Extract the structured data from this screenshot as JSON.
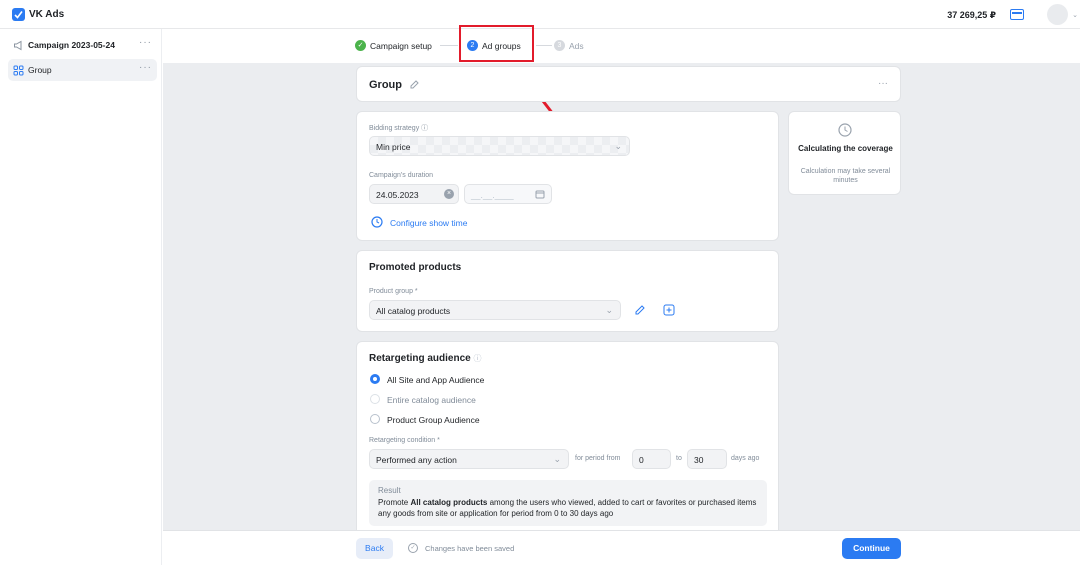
{
  "app": {
    "title": "VK Ads",
    "balance": "37 269,25 ₽"
  },
  "sidebar": {
    "items": [
      {
        "label": "Campaign 2023-05-24",
        "more": "···"
      },
      {
        "label": "Group",
        "more": "···"
      }
    ]
  },
  "steps": [
    {
      "label": "Campaign setup",
      "marker": "✓",
      "state": "done"
    },
    {
      "label": "Ad groups",
      "marker": "2",
      "state": "active"
    },
    {
      "label": "Ads",
      "marker": "3",
      "state": "pending"
    }
  ],
  "group_header": {
    "title": "Group",
    "more": "···"
  },
  "bidding": {
    "label": "Bidding strategy",
    "value": "Min price",
    "duration_label": "Campaign's duration",
    "start_date": "24.05.2023",
    "end_placeholder": "__.__.____",
    "configure_link": "Configure show time"
  },
  "coverage": {
    "title": "Calculating the coverage",
    "subtitle": "Calculation may take several minutes"
  },
  "promoted": {
    "title": "Promoted products",
    "field_label": "Product group *",
    "value": "All catalog products"
  },
  "retargeting": {
    "title": "Retargeting audience",
    "options": [
      {
        "label": "All Site and App Audience",
        "checked": true,
        "disabled": false
      },
      {
        "label": "Entire catalog audience",
        "checked": false,
        "disabled": true
      },
      {
        "label": "Product Group Audience",
        "checked": false,
        "disabled": false
      }
    ],
    "condition_label": "Retargeting condition *",
    "condition_value": "Performed any action",
    "period_from_label": "for period from",
    "from_value": "0",
    "to_label": "to",
    "to_value": "30",
    "days_ago": "days ago",
    "result_title": "Result",
    "result_pre": "Promote ",
    "result_bold": "All catalog products",
    "result_post": " among the users who viewed, added to cart or favorites or purchased items any goods from site or application for period from 0 to 30 days ago"
  },
  "footer": {
    "back": "Back",
    "saved": "Changes have been saved",
    "continue": "Continue"
  },
  "colors": {
    "accent": "#2b7bf2",
    "success": "#4bb34b",
    "highlight": "#e21b2b"
  }
}
